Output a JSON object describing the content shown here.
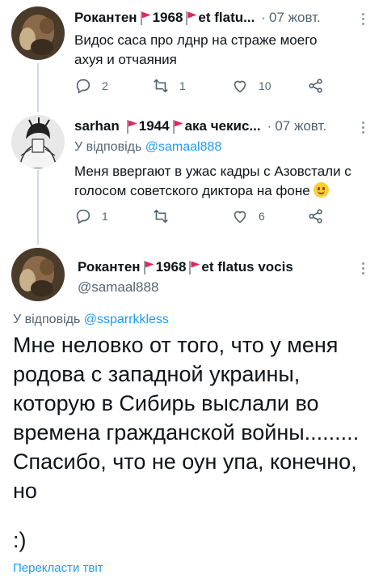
{
  "tweet1": {
    "name": "Рокантен",
    "name_rest": "1968",
    "name_tail": "et flatu...",
    "date": "07 жовт.",
    "text": "Видос саса про лднр на страже моего ахуя и отчаяния",
    "replies": "2",
    "retweets": "1",
    "likes": "10"
  },
  "tweet2": {
    "name": "sarhan",
    "name_rest": "1944",
    "name_tail": "ака чекис...",
    "date": "07 жовт.",
    "reply_prefix": "У відповідь",
    "reply_handle": "@samaal888",
    "text": "Меня ввергают в ужас кадры с Азовстали с голосом советского диктора на фоне",
    "replies": "1",
    "retweets": "",
    "likes": "6"
  },
  "tweet3": {
    "name": "Рокантен",
    "name_rest": "1968",
    "name_tail": "et flatus vocis",
    "handle": "@samaal888",
    "reply_prefix": "У відповідь",
    "reply_handle": "@ssparrkkless",
    "text": "Мне неловко от того, что у меня родова с западной украины, которую в Сибирь выслали во времена гражданской войны......... Спасибо, что не оун упа, конечно, но",
    "smile": ":)",
    "translate": "Перекласти твіт"
  },
  "colors": {
    "link": "#1d9bf0",
    "muted": "#536471",
    "flag": "#e0245e"
  }
}
